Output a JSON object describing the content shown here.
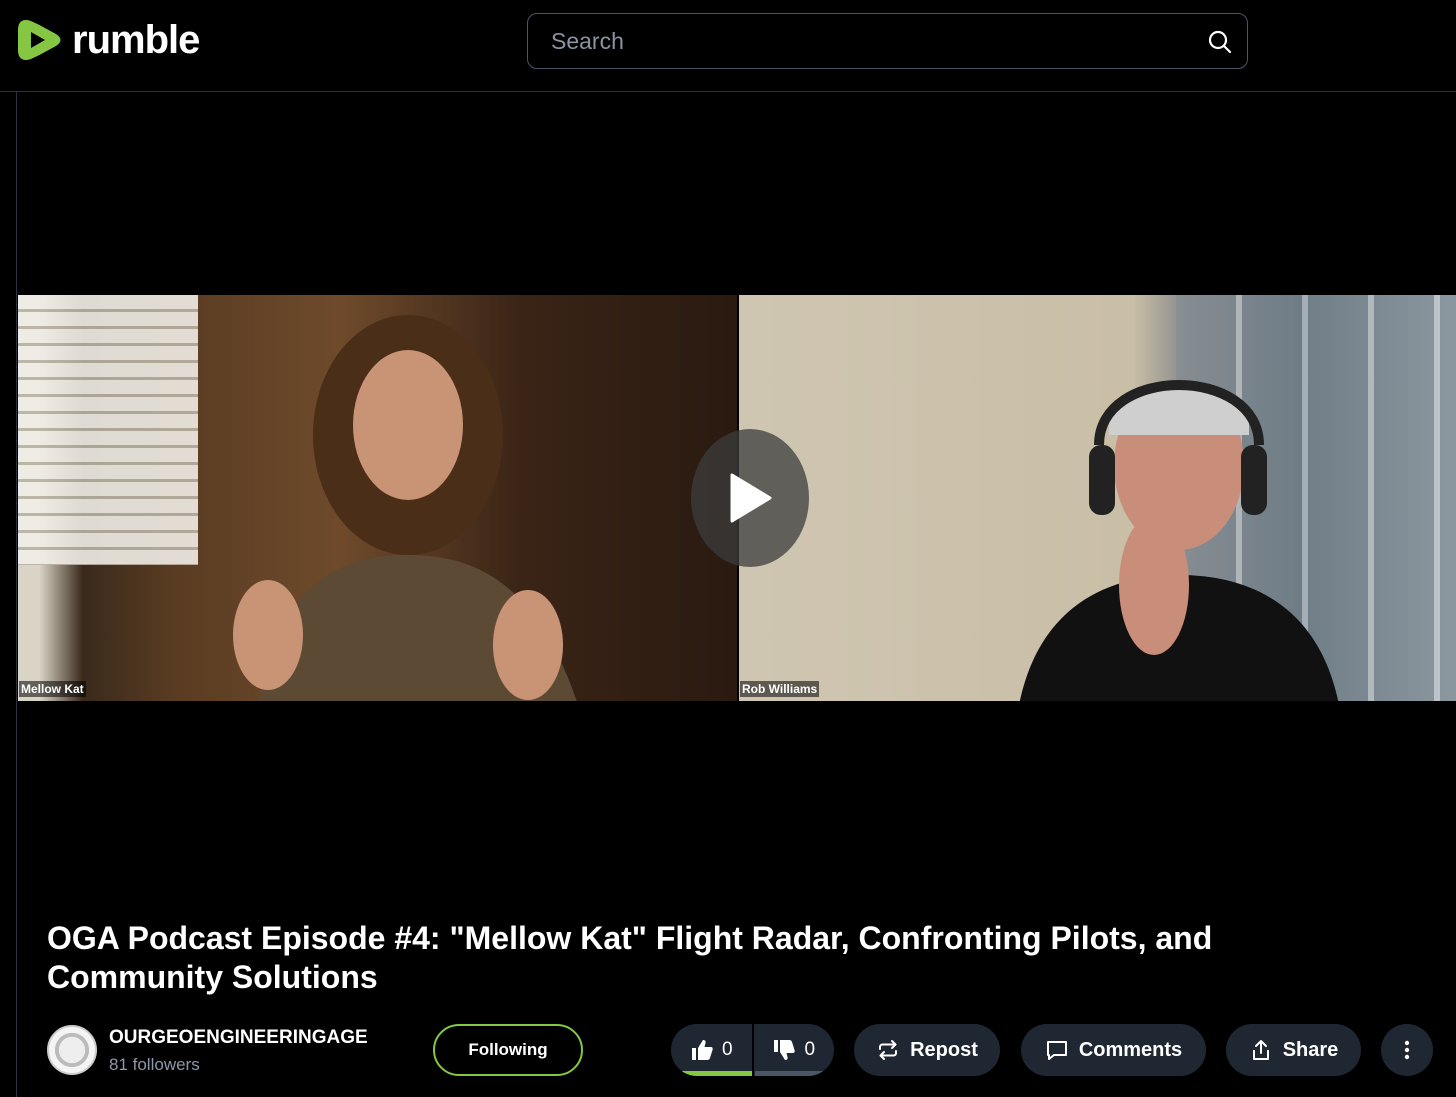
{
  "header": {
    "logo_text": "rumble",
    "search_placeholder": "Search"
  },
  "player": {
    "left_participant": "Mellow Kat",
    "right_participant": "Rob Williams"
  },
  "video": {
    "title": "OGA Podcast Episode #4: \"Mellow Kat\" Flight Radar, Confronting Pilots, and Community Solutions"
  },
  "channel": {
    "name": "OURGEOENGINEERINGAGE",
    "followers": "81 followers",
    "follow_label": "Following"
  },
  "actions": {
    "likes": "0",
    "dislikes": "0",
    "repost_label": "Repost",
    "comments_label": "Comments",
    "share_label": "Share"
  },
  "colors": {
    "brand_green": "#85c742",
    "button_bg": "#1f2733",
    "muted_text": "#8e97a8"
  }
}
